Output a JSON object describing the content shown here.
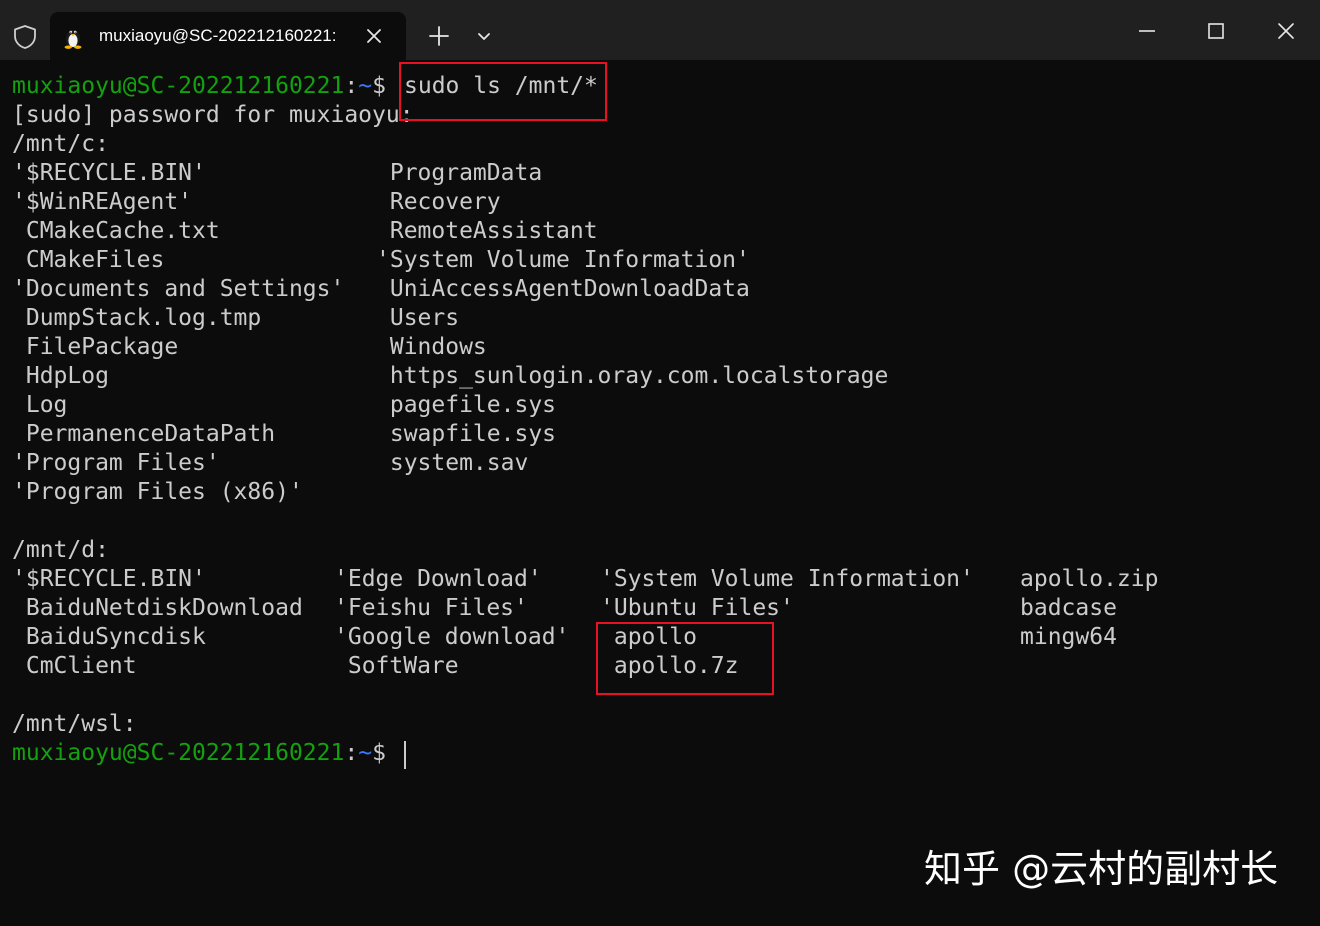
{
  "window": {
    "tab_title": "muxiaoyu@SC-202212160221:",
    "icons": {
      "shield": "shield-icon",
      "tab": "linux-penguin-icon",
      "close_tab": "close-icon",
      "new_tab": "plus-icon",
      "dropdown": "chevron-down-icon",
      "minimize": "minimize-icon",
      "maximize": "maximize-icon",
      "close_window": "close-icon"
    }
  },
  "colors": {
    "background": "#0c0c0c",
    "titlebar": "#202020",
    "prompt_user": "#13a10e",
    "prompt_path": "#3b78ff",
    "text": "#cccccc",
    "highlight": "#e81123"
  },
  "terminal": {
    "prompt1": {
      "user": "muxiaoyu@SC-202212160221",
      "colon": ":",
      "path": "~",
      "dollar": "$ ",
      "command": "sudo ls /mnt/*"
    },
    "sudo_line": "[sudo] password for muxiaoyu:",
    "c_header": "/mnt/c:",
    "c_left": [
      "'$RECYCLE.BIN'",
      "'$WinREAgent'",
      " CMakeCache.txt",
      " CMakeFiles",
      "'Documents and Settings'",
      " DumpStack.log.tmp",
      " FilePackage",
      " HdpLog",
      " Log",
      " PermanenceDataPath",
      "'Program Files'",
      "'Program Files (x86)'"
    ],
    "c_right": [
      " ProgramData",
      " Recovery",
      " RemoteAssistant",
      "'System Volume Information'",
      " UniAccessAgentDownloadData",
      " Users",
      " Windows",
      " https_sunlogin.oray.com.localstorage",
      " pagefile.sys",
      " swapfile.sys",
      " system.sav"
    ],
    "d_header": "/mnt/d:",
    "d_col1": [
      "'$RECYCLE.BIN'",
      " BaiduNetdiskDownload",
      " BaiduSyncdisk",
      " CmClient"
    ],
    "d_col2": [
      "'Edge Download'",
      "'Feishu Files'",
      "'Google download'",
      " SoftWare"
    ],
    "d_col3": [
      "'System Volume Information'",
      "'Ubuntu Files'",
      " apollo",
      " apollo.7z"
    ],
    "d_col4": [
      "apollo.zip",
      "badcase",
      "mingw64"
    ],
    "wsl_header": "/mnt/wsl:",
    "prompt2": {
      "user": "muxiaoyu@SC-202212160221",
      "colon": ":",
      "path": "~",
      "dollar": "$ "
    }
  },
  "watermark": "知乎 @云村的副村长"
}
